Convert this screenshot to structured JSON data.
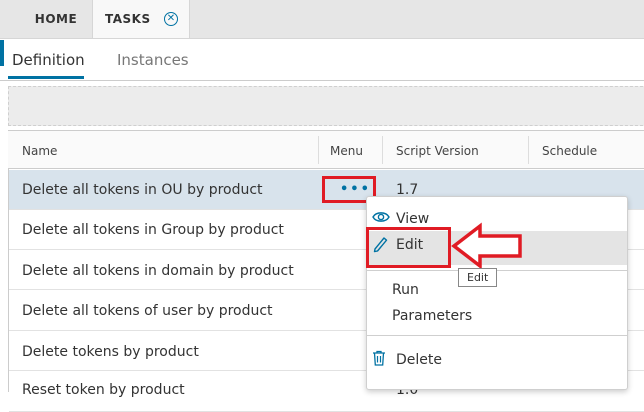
{
  "top_tabs": {
    "home": "HOME",
    "tasks": "TASKS",
    "close_glyph": "✕"
  },
  "sub_tabs": {
    "definition": "Definition",
    "instances": "Instances"
  },
  "grid": {
    "columns": {
      "name": "Name",
      "menu": "Menu",
      "script_version": "Script Version",
      "schedule": "Schedule"
    },
    "rows": [
      {
        "name": "Delete all tokens in OU by product",
        "version": "1.7"
      },
      {
        "name": "Delete all tokens in Group by product",
        "version": ""
      },
      {
        "name": "Delete all tokens in domain by product",
        "version": ""
      },
      {
        "name": "Delete all tokens of user by product",
        "version": ""
      },
      {
        "name": "Delete tokens by product",
        "version": ""
      },
      {
        "name": "Reset token by product",
        "version": "1.0"
      }
    ],
    "menu_dots": "•••"
  },
  "context_menu": {
    "view": "View",
    "edit": "Edit",
    "run": "Run",
    "parameters": "Parameters",
    "delete": "Delete"
  },
  "tooltip": "Edit",
  "colors": {
    "accent": "#0072a3",
    "annotation_red": "#e01b24"
  }
}
